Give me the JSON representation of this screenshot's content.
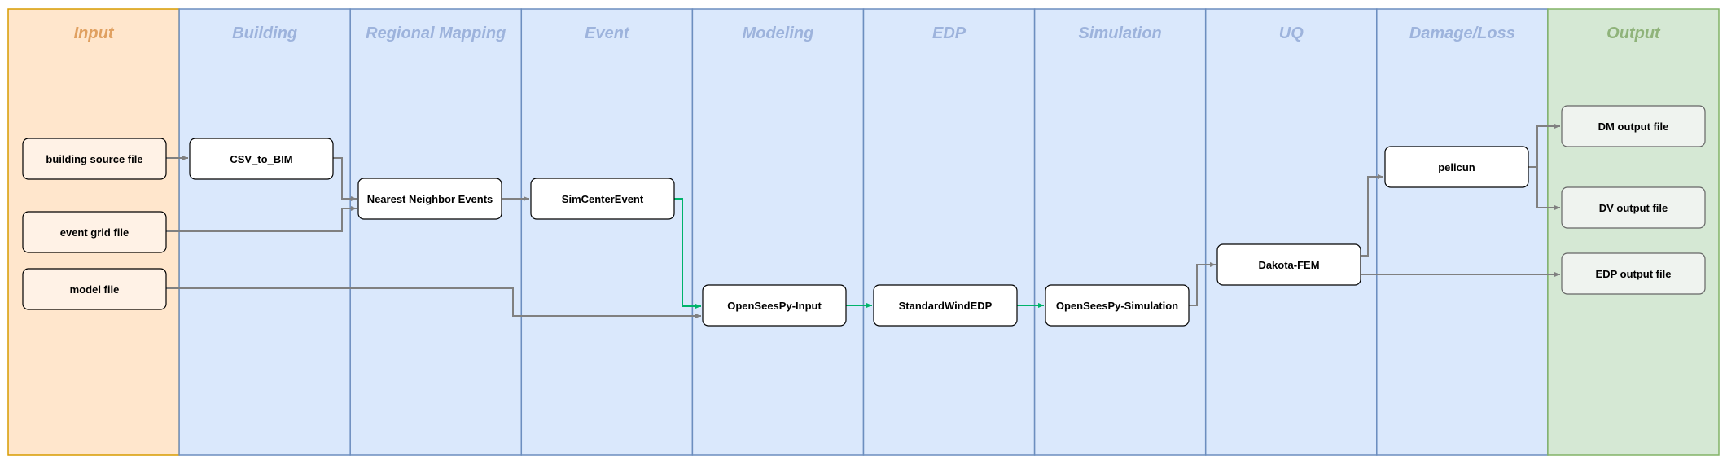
{
  "lanes": [
    {
      "title": "Input",
      "fill": "#ffe6cc",
      "stroke": "#d79b00",
      "title_color": "#e0a060"
    },
    {
      "title": "Building",
      "fill": "#dae8fc",
      "stroke": "#6c8ebf",
      "title_color": "#9db3dc"
    },
    {
      "title": "Regional Mapping",
      "fill": "#dae8fc",
      "stroke": "#6c8ebf",
      "title_color": "#9db3dc"
    },
    {
      "title": "Event",
      "fill": "#dae8fc",
      "stroke": "#6c8ebf",
      "title_color": "#9db3dc"
    },
    {
      "title": "Modeling",
      "fill": "#dae8fc",
      "stroke": "#6c8ebf",
      "title_color": "#9db3dc"
    },
    {
      "title": "EDP",
      "fill": "#dae8fc",
      "stroke": "#6c8ebf",
      "title_color": "#9db3dc"
    },
    {
      "title": "Simulation",
      "fill": "#dae8fc",
      "stroke": "#6c8ebf",
      "title_color": "#9db3dc"
    },
    {
      "title": "UQ",
      "fill": "#dae8fc",
      "stroke": "#6c8ebf",
      "title_color": "#9db3dc"
    },
    {
      "title": "Damage/Loss",
      "fill": "#dae8fc",
      "stroke": "#6c8ebf",
      "title_color": "#9db3dc"
    },
    {
      "title": "Output",
      "fill": "#d5e8d4",
      "stroke": "#82b366",
      "title_color": "#8fb37a"
    }
  ],
  "nodes": {
    "building_source_file": "building source file",
    "event_grid_file": "event grid file",
    "model_file": "model file",
    "csv_to_bim": "CSV_to_BIM",
    "nearest_neighbor_events": "Nearest Neighbor Events",
    "simcenter_event": "SimCenterEvent",
    "opensees_input": "OpenSeesPy-Input",
    "standard_wind_edp": "StandardWindEDP",
    "opensees_simulation": "OpenSeesPy-Simulation",
    "dakota_fem": "Dakota-FEM",
    "pelicun": "pelicun",
    "dm_output_file": "DM output file",
    "dv_output_file": "DV output file",
    "edp_output_file": "EDP output file"
  },
  "colors": {
    "input_node_fill": "#fff2e6",
    "process_node_fill": "#ffffff",
    "output_node_fill": "#eff3ef",
    "edge": "#808080",
    "edge_highlight": "#00b36b"
  }
}
